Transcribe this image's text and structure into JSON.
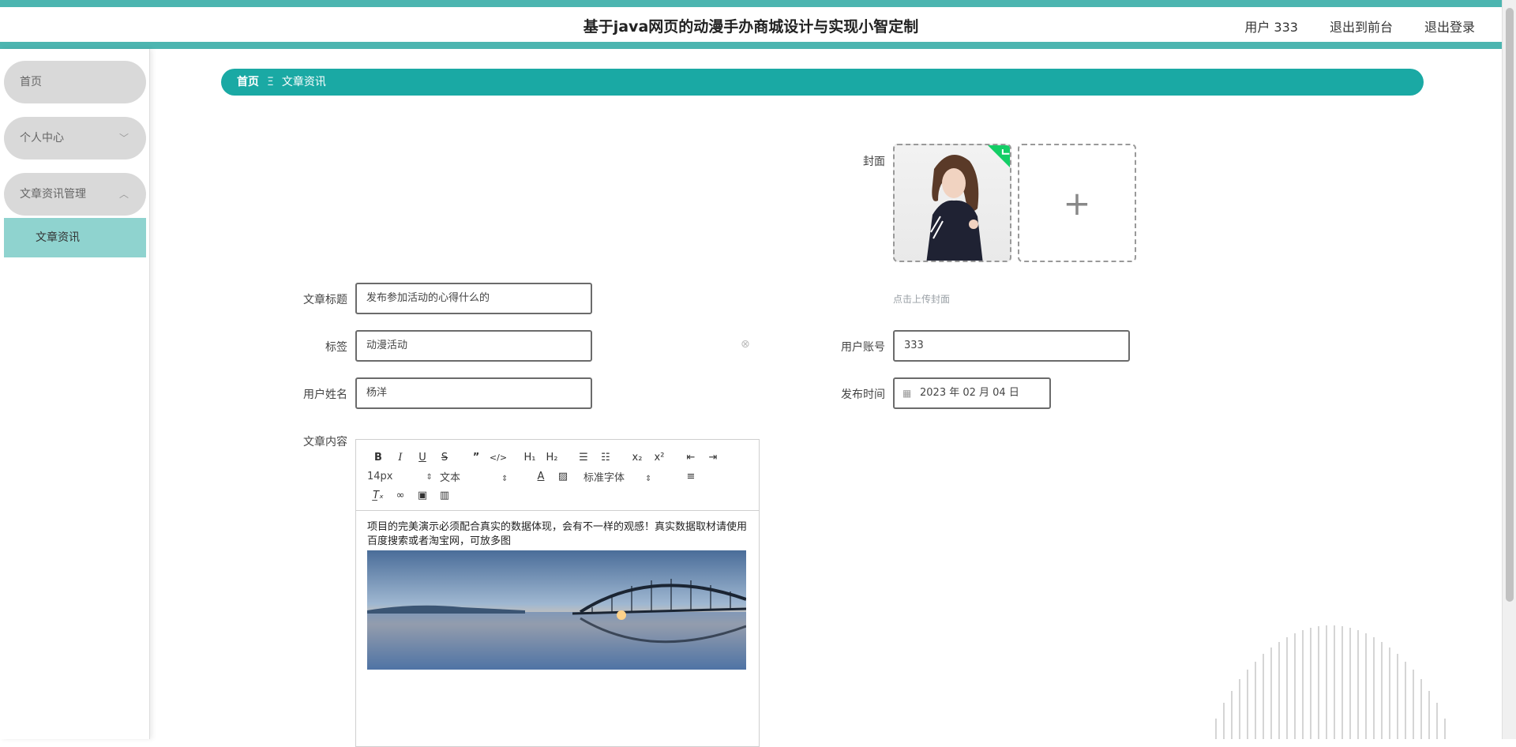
{
  "header": {
    "title": "基于java网页的动漫手办商城设计与实现小智定制",
    "user": "用户 333",
    "back_front": "退出到前台",
    "logout": "退出登录"
  },
  "sidebar": {
    "items": [
      {
        "label": "首页"
      },
      {
        "label": "个人中心",
        "arrow": "﹀"
      },
      {
        "label": "文章资讯管理",
        "arrow": "︿"
      }
    ],
    "sub_item": "文章资讯"
  },
  "breadcrumb": {
    "home": "首页",
    "separator": "Ξ",
    "current": "文章资讯"
  },
  "form": {
    "cover_label": "封面",
    "upload_hint": "点击上传封面",
    "upload_plus": "+",
    "title_label": "文章标题",
    "title_value": "发布参加活动的心得什么的",
    "tag_label": "标签",
    "tag_value": "动漫活动",
    "account_label": "用户账号",
    "account_value": "333",
    "name_label": "用户姓名",
    "name_value": "杨洋",
    "time_label": "发布时间",
    "time_value": "2023 年 02 月 04 日",
    "content_label": "文章内容"
  },
  "editor": {
    "size_select": "14px",
    "text_select": "文本",
    "font_select": "标准字体",
    "content": "项目的完美演示必须配合真实的数据体现，会有不一样的观感！真实数据取材请使用百度搜索或者淘宝网，可放多图"
  },
  "colors": {
    "teal_bar": "#4cb5b0",
    "breadcrumb": "#1aa9a4",
    "submenu": "#8fd3cf",
    "menu_pill": "#d9d9d9"
  }
}
